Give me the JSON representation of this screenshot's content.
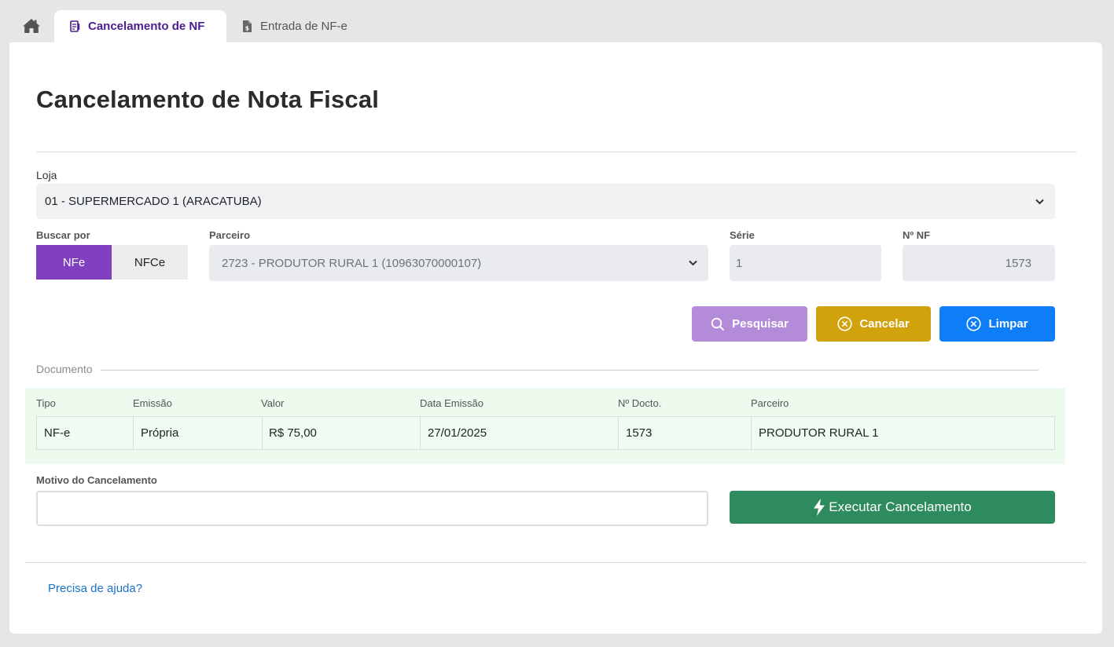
{
  "tabs": {
    "home_icon": "home-icon",
    "active": {
      "label": "Cancelamento de NF",
      "icon": "document-icon"
    },
    "inactive": {
      "label": "Entrada de NF-e",
      "icon": "file-dollar-icon"
    }
  },
  "page": {
    "title": "Cancelamento de Nota Fiscal"
  },
  "form": {
    "loja_label": "Loja",
    "loja_value": "01 - SUPERMERCADO 1 (ARACATUBA)",
    "buscar_label": "Buscar por",
    "buscar_options": [
      "NFe",
      "NFCe"
    ],
    "buscar_selected": "NFe",
    "parceiro_label": "Parceiro",
    "parceiro_value": "2723 - PRODUTOR RURAL 1 (10963070000107)",
    "serie_label": "Série",
    "serie_value": "1",
    "nnf_label": "Nº NF",
    "nnf_value": "1573"
  },
  "actions": {
    "pesquisar": "Pesquisar",
    "cancelar": "Cancelar",
    "limpar": "Limpar"
  },
  "documento": {
    "legend": "Documento",
    "columns": [
      "Tipo",
      "Emissão",
      "Valor",
      "Data Emissão",
      "Nº Docto.",
      "Parceiro"
    ],
    "row": [
      "NF-e",
      "Própria",
      "R$ 75,00",
      "27/01/2025",
      "1573",
      "PRODUTOR RURAL 1"
    ]
  },
  "motivo": {
    "label": "Motivo do Cancelamento",
    "value": "",
    "execute_label": "Executar Cancelamento"
  },
  "footer": {
    "help_link": "Precisa de ajuda?"
  },
  "colors": {
    "active_tab_text": "#4b1d8f",
    "segment_on": "#7f3fbf",
    "pesquisar": "#b48bd8",
    "cancelar": "#d1a20c",
    "limpar": "#0d7ef8",
    "executar": "#2e8b5e",
    "doc_panel": "#edfbef",
    "link": "#1a73c8"
  }
}
